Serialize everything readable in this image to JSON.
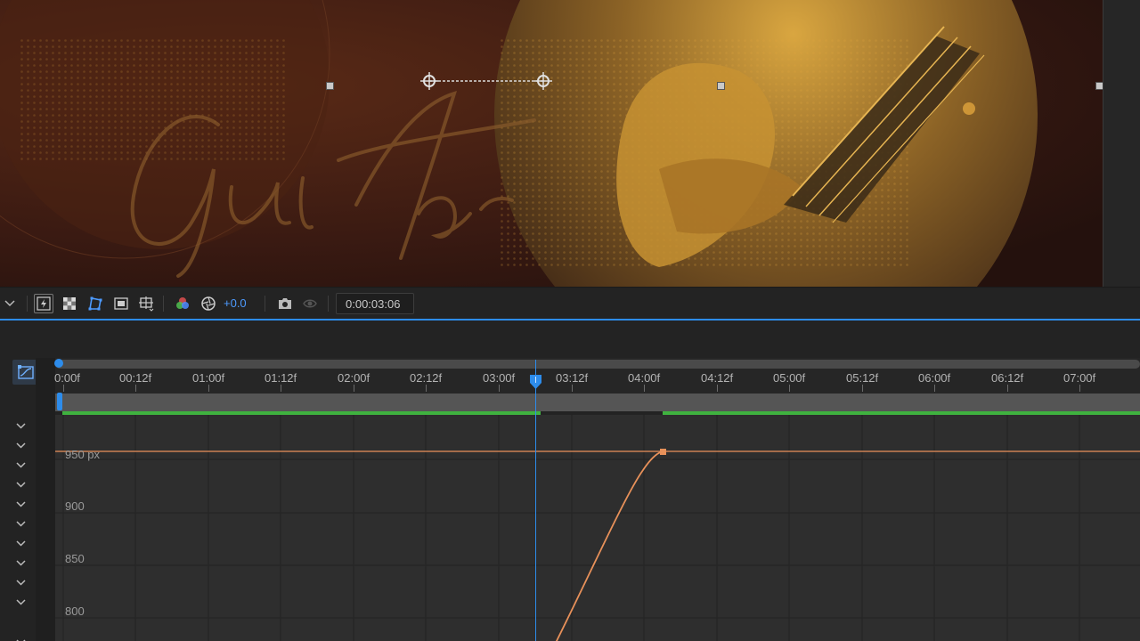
{
  "viewer": {
    "artwork_text": "Guitar"
  },
  "toolbar": {
    "exposure": "+0.0",
    "timecode": "0:00:03:06",
    "icons": [
      "dropdown-icon",
      "fast-previews-icon",
      "transparency-grid-icon",
      "mask-visibility-icon",
      "region-of-interest-icon",
      "guides-icon",
      "channel-icon",
      "reset-exposure-icon",
      "snapshot-icon",
      "show-snapshot-icon"
    ]
  },
  "ruler": {
    "ticks": [
      "0:00f",
      "00:12f",
      "01:00f",
      "01:12f",
      "02:00f",
      "02:12f",
      "03:00f",
      "03:12f",
      "04:00f",
      "04:12f",
      "05:00f",
      "05:12f",
      "06:00f",
      "06:12f",
      "07:00f"
    ]
  },
  "graph": {
    "value_labels": [
      "950 px",
      "900",
      "850",
      "800"
    ],
    "curve_color": "#e8915a",
    "keyframe_end_value": "950 px"
  },
  "colors": {
    "accent": "#2d8ceb",
    "cache": "#3fb23f"
  }
}
